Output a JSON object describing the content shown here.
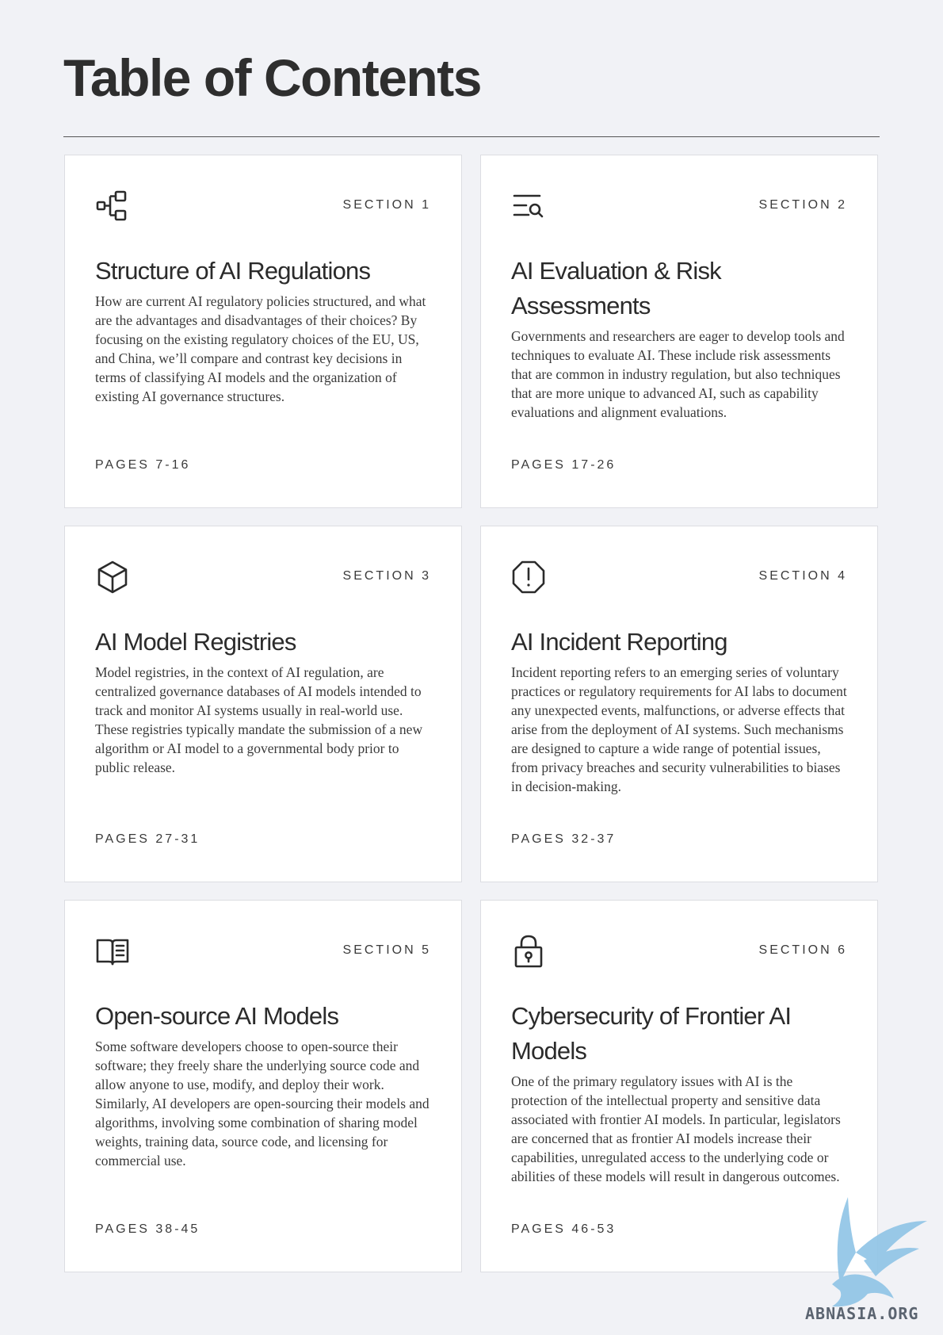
{
  "page": {
    "title": "Table of Contents"
  },
  "sections": [
    {
      "label": "SECTION 1",
      "icon": "hierarchy-icon",
      "title": "Structure of AI Regulations",
      "description": "How are current AI regulatory policies structured, and what are the advantages and disadvantages of their choices? By focusing on the existing regulatory choices of the EU, US, and China, we’ll compare and contrast key decisions in terms of classifying AI models and the organization of existing AI governance structures.",
      "pages": "PAGES 7-16"
    },
    {
      "label": "SECTION 2",
      "icon": "search-list-icon",
      "title": "AI Evaluation & Risk Assessments",
      "description": "Governments and researchers are eager to develop tools and techniques to evaluate AI. These include risk assessments that are common in industry regulation, but also techniques that are more unique to advanced AI, such as capability evaluations and alignment evaluations.",
      "pages": "PAGES 17-26"
    },
    {
      "label": "SECTION 3",
      "icon": "cube-icon",
      "title": "AI Model Registries",
      "description": "Model registries, in the context of AI regulation, are centralized governance databases of AI models intended to track and monitor AI systems usually in real-world use. These registries typically mandate the submission of a new algorithm or AI model to a governmental body prior to public release.",
      "pages": "PAGES 27-31"
    },
    {
      "label": "SECTION 4",
      "icon": "alert-octagon-icon",
      "title": "AI Incident Reporting",
      "description": "Incident reporting refers to an emerging series of voluntary practices or regulatory requirements for AI labs to document any unexpected events, malfunctions, or adverse effects that arise from the deployment of AI systems. Such mechanisms are designed to capture a wide range of potential issues, from privacy breaches and security vulnerabilities to biases in decision-making.",
      "pages": "PAGES 32-37"
    },
    {
      "label": "SECTION 5",
      "icon": "open-book-icon",
      "title": "Open-source AI Models",
      "description": "Some software developers choose to open-source their software; they freely share the underlying source code and allow anyone to use, modify, and deploy their work. Similarly, AI developers are open-sourcing their models and algorithms, involving some combination of sharing model weights, training data, source code, and licensing for commercial use.",
      "pages": "PAGES 38-45"
    },
    {
      "label": "SECTION 6",
      "icon": "padlock-icon",
      "title": "Cybersecurity of Frontier AI Models",
      "description": "One of the primary regulatory issues with AI is the protection of the intellectual property and sensitive data associated with frontier AI models. In particular, legislators are concerned that as frontier AI models increase their capabilities, unregulated access to the underlying code or abilities of these models will result in dangerous outcomes.",
      "pages": "PAGES 46-53"
    }
  ],
  "watermark": {
    "text": "ABNASIA.ORG"
  },
  "colors": {
    "background": "#f1f2f6",
    "card": "#ffffff",
    "text": "#2b2b2b",
    "watermark": "#8fc4e6"
  }
}
